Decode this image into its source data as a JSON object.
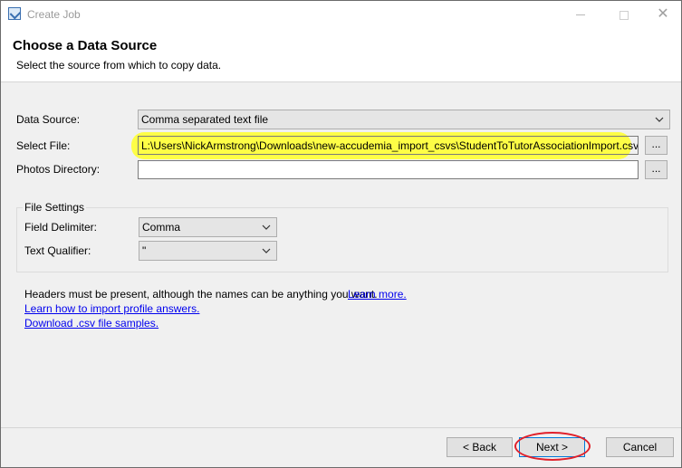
{
  "window": {
    "title": "Create Job",
    "controls": {
      "minimize": "minimize",
      "maximize": "maximize",
      "close": "✕"
    }
  },
  "header": {
    "title": "Choose a Data Source",
    "subtitle": "Select the source from which to copy data."
  },
  "form": {
    "data_source_label": "Data Source:",
    "data_source_value": "Comma separated text file",
    "select_file_label": "Select File:",
    "select_file_value": "L:\\Users\\NickArmstrong\\Downloads\\new-accudemia_import_csvs\\StudentToTutorAssociationImport.csv",
    "photos_dir_label": "Photos Directory:",
    "photos_dir_value": "",
    "browse_label": "..."
  },
  "file_settings": {
    "title": "File Settings",
    "field_delimiter_label": "Field Delimiter:",
    "field_delimiter_value": "Comma",
    "text_qualifier_label": "Text Qualifier:",
    "text_qualifier_value": "\""
  },
  "info": {
    "headers_note": "Headers must be present, although the names can be anything you want.",
    "learn_more": "Learn more.",
    "learn_profile": "Learn how to import profile answers.",
    "download_samples": "Download .csv file samples."
  },
  "buttons": {
    "back": "< Back",
    "next": "Next >",
    "cancel": "Cancel"
  },
  "colors": {
    "highlight": "#ffff33",
    "annotation_ring": "#e0202a",
    "link": "#0000ee"
  }
}
